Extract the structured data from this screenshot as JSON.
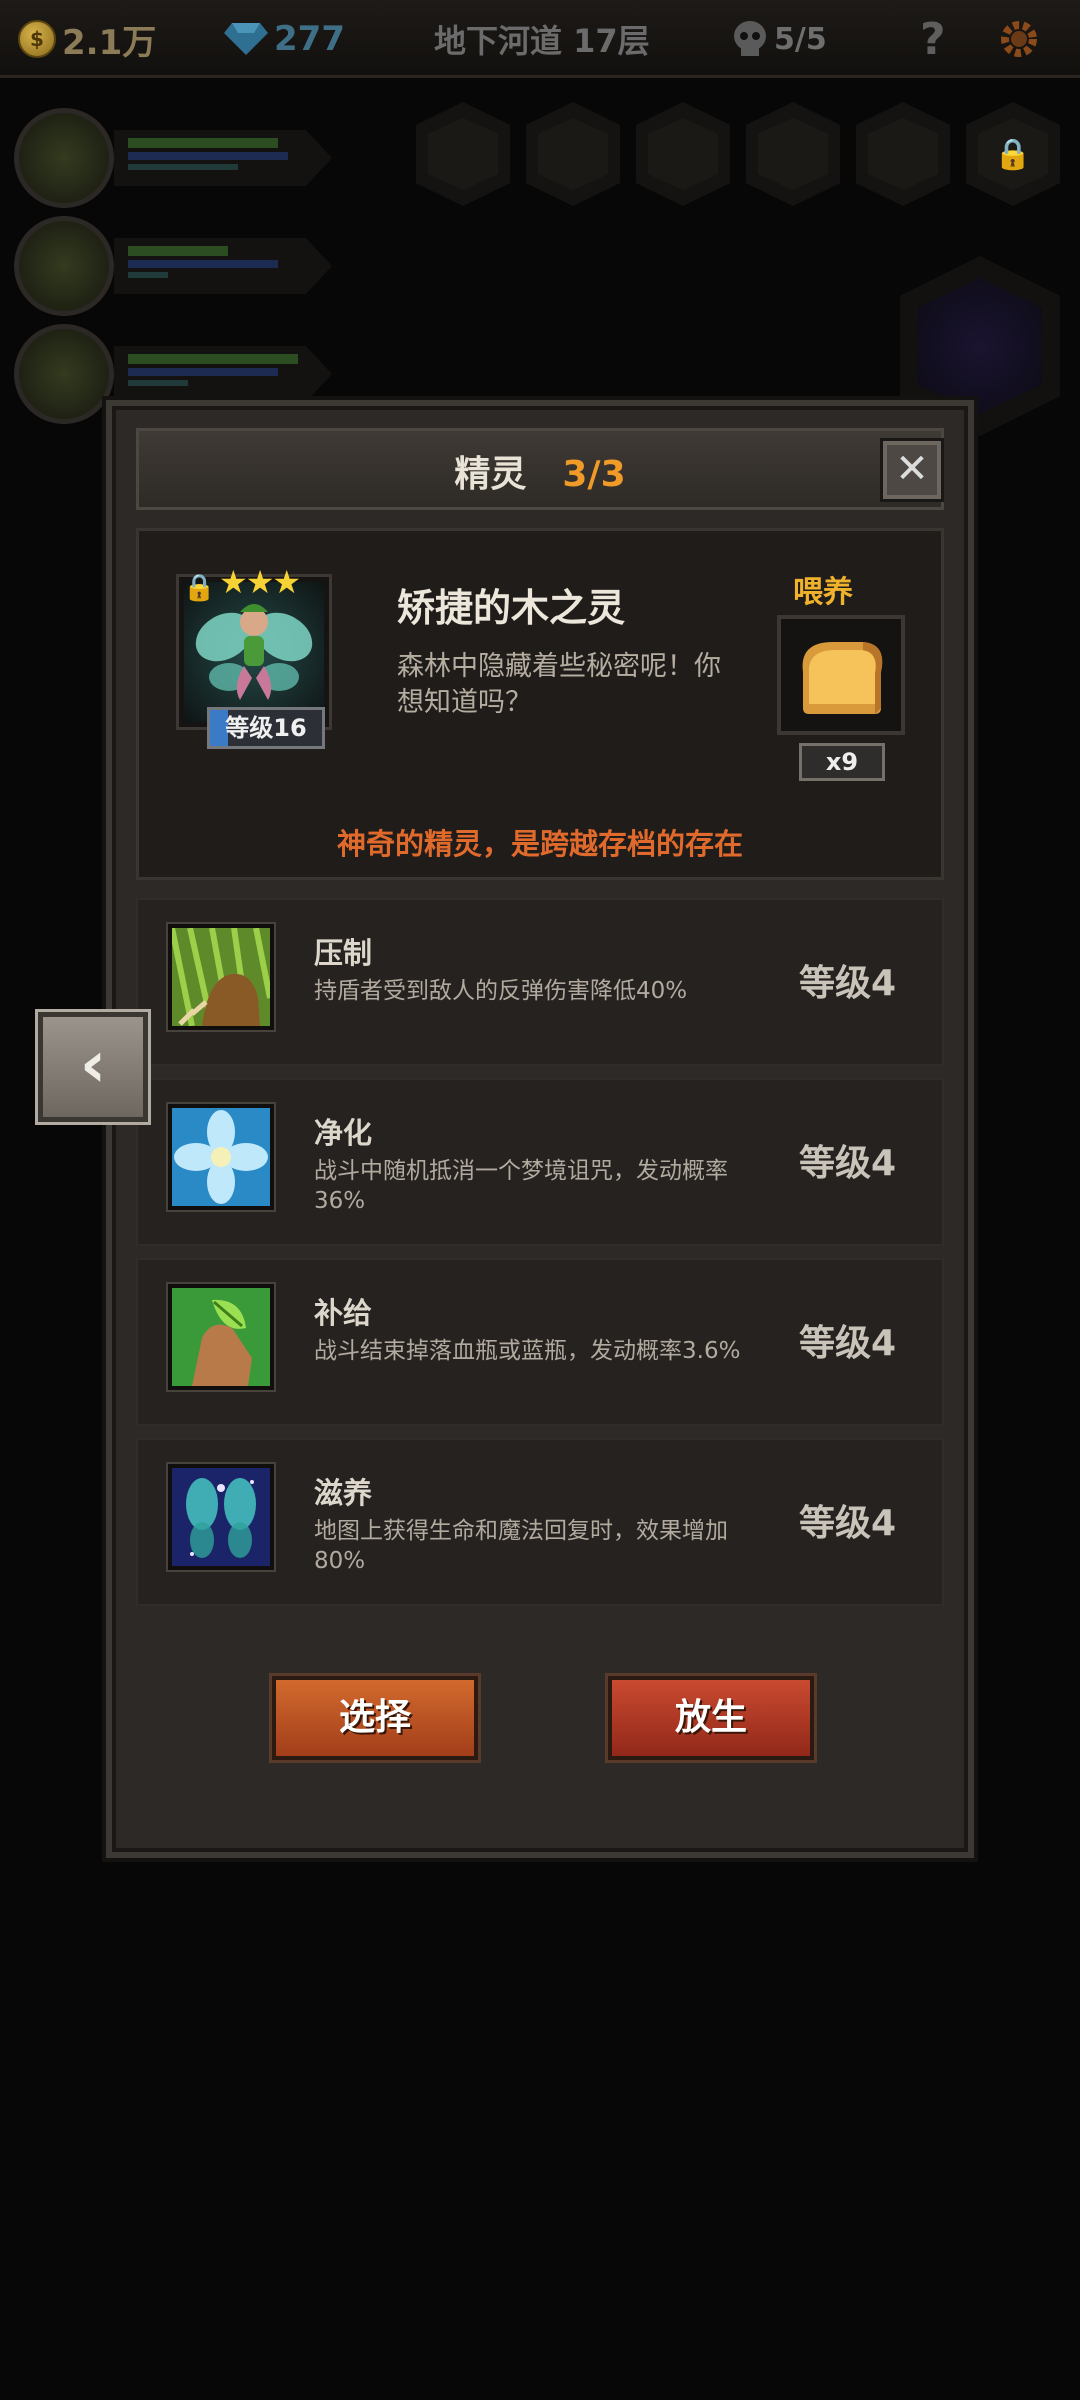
{
  "topbar": {
    "gold": "2.1万",
    "gold_icon": "$",
    "gems": "277",
    "floor": "地下河道 17层",
    "skulls": "5/5",
    "help": "?"
  },
  "modal": {
    "title": "精灵",
    "count": "3/3",
    "close": "✕"
  },
  "spirit": {
    "name": "矫捷的木之灵",
    "description": "森林中隐藏着些秘密呢！你想知道吗？",
    "stars": "★★★",
    "level": "等级16",
    "feed_label": "喂养",
    "feed_count": "x9",
    "motto": "神奇的精灵，是跨越存档的存在"
  },
  "skills": [
    {
      "name": "压制",
      "description": "持盾者受到敌人的反弹伤害降低40%",
      "level": "等级4",
      "icon": "claw-icon"
    },
    {
      "name": "净化",
      "description": "战斗中随机抵消一个梦境诅咒，发动概率36%",
      "level": "等级4",
      "icon": "flower-icon"
    },
    {
      "name": "补给",
      "description": "战斗结束掉落血瓶或蓝瓶，发动概率3.6%",
      "level": "等级4",
      "icon": "leaf-hand-icon"
    },
    {
      "name": "滋养",
      "description": "地图上获得生命和魔法回复时，效果增加80%",
      "level": "等级4",
      "icon": "fairy-icon"
    }
  ],
  "buttons": {
    "select": "选择",
    "release": "放生"
  },
  "nav": {
    "prev": "‹"
  }
}
